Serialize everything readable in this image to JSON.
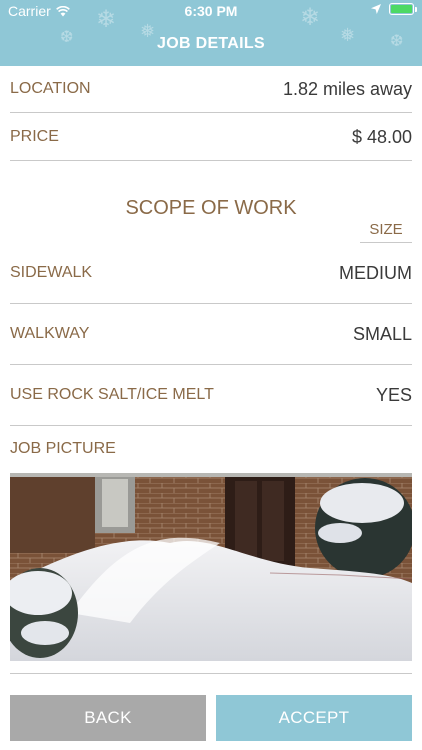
{
  "status_bar": {
    "carrier": "Carrier",
    "time": "6:30 PM",
    "battery_level": 1.0
  },
  "nav": {
    "title": "JOB DETAILS"
  },
  "details": {
    "location_label": "LOCATION",
    "location_value": "1.82 miles away",
    "price_label": "PRICE",
    "price_value": "$ 48.00"
  },
  "scope": {
    "title": "SCOPE OF WORK",
    "size_header": "SIZE",
    "items": [
      {
        "label": "SIDEWALK",
        "value": "MEDIUM"
      },
      {
        "label": "WALKWAY",
        "value": "SMALL"
      },
      {
        "label": "USE ROCK SALT/ICE MELT",
        "value": "YES"
      }
    ]
  },
  "picture": {
    "label": "JOB PICTURE"
  },
  "buttons": {
    "back": "BACK",
    "accept": "ACCEPT"
  },
  "colors": {
    "header": "#8fc7d6",
    "label": "#8a6a48",
    "back_button": "#a9a9a9",
    "accept_button": "#8fc7d6",
    "battery": "#4cd964"
  },
  "icons": [
    "wifi-icon",
    "location-arrow-icon",
    "battery-icon",
    "snowflake-pattern"
  ]
}
